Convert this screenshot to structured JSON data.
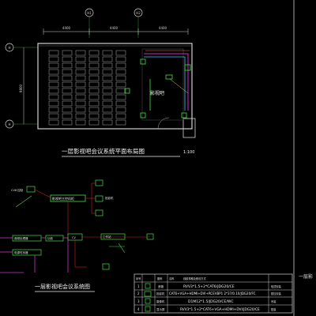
{
  "plan": {
    "axes": [
      "H1",
      "H2",
      "H",
      "H"
    ],
    "dims": [
      "4400",
      "4400",
      "4400"
    ],
    "side_dim": "9800",
    "room_label": "影视吧",
    "title": "一层影视吧会议系统平面布局图",
    "scale": "1:100"
  },
  "system": {
    "title": "一层影视吧会议系统图",
    "labels": [
      "影视吧主控机柜",
      "CV8 控制",
      "投影机",
      "音频处理器",
      "电源时序器",
      "功放",
      "CV",
      "工作站"
    ]
  },
  "legend": {
    "header": [
      "序号",
      "图例",
      "名称",
      "线缆规格及敷设方式"
    ],
    "rows": [
      {
        "no": "1",
        "name": "音箱",
        "spec": "RVV3*1.5+2*CAT6/JDG20/CE"
      },
      {
        "no": "2",
        "name": "投影机",
        "spec": "CAT6+VGA+HDMI+DVI+RCEVBP1 2*37/0.10/JDG20/FC"
      },
      {
        "no": "3",
        "name": "摄像机",
        "spec": "D1M12*1.5/JDG20/CE/WC"
      },
      {
        "no": "4",
        "name": "显示屏",
        "spec": "RVV3*1.5+2*CAT6+VGA+HDMI+DVI/JDG20/CE"
      }
    ],
    "side_notes": [
      "吸顶安装",
      "壁挂安装",
      "吊装",
      "壁装"
    ]
  },
  "right_panel": {
    "caption": "一层影"
  }
}
